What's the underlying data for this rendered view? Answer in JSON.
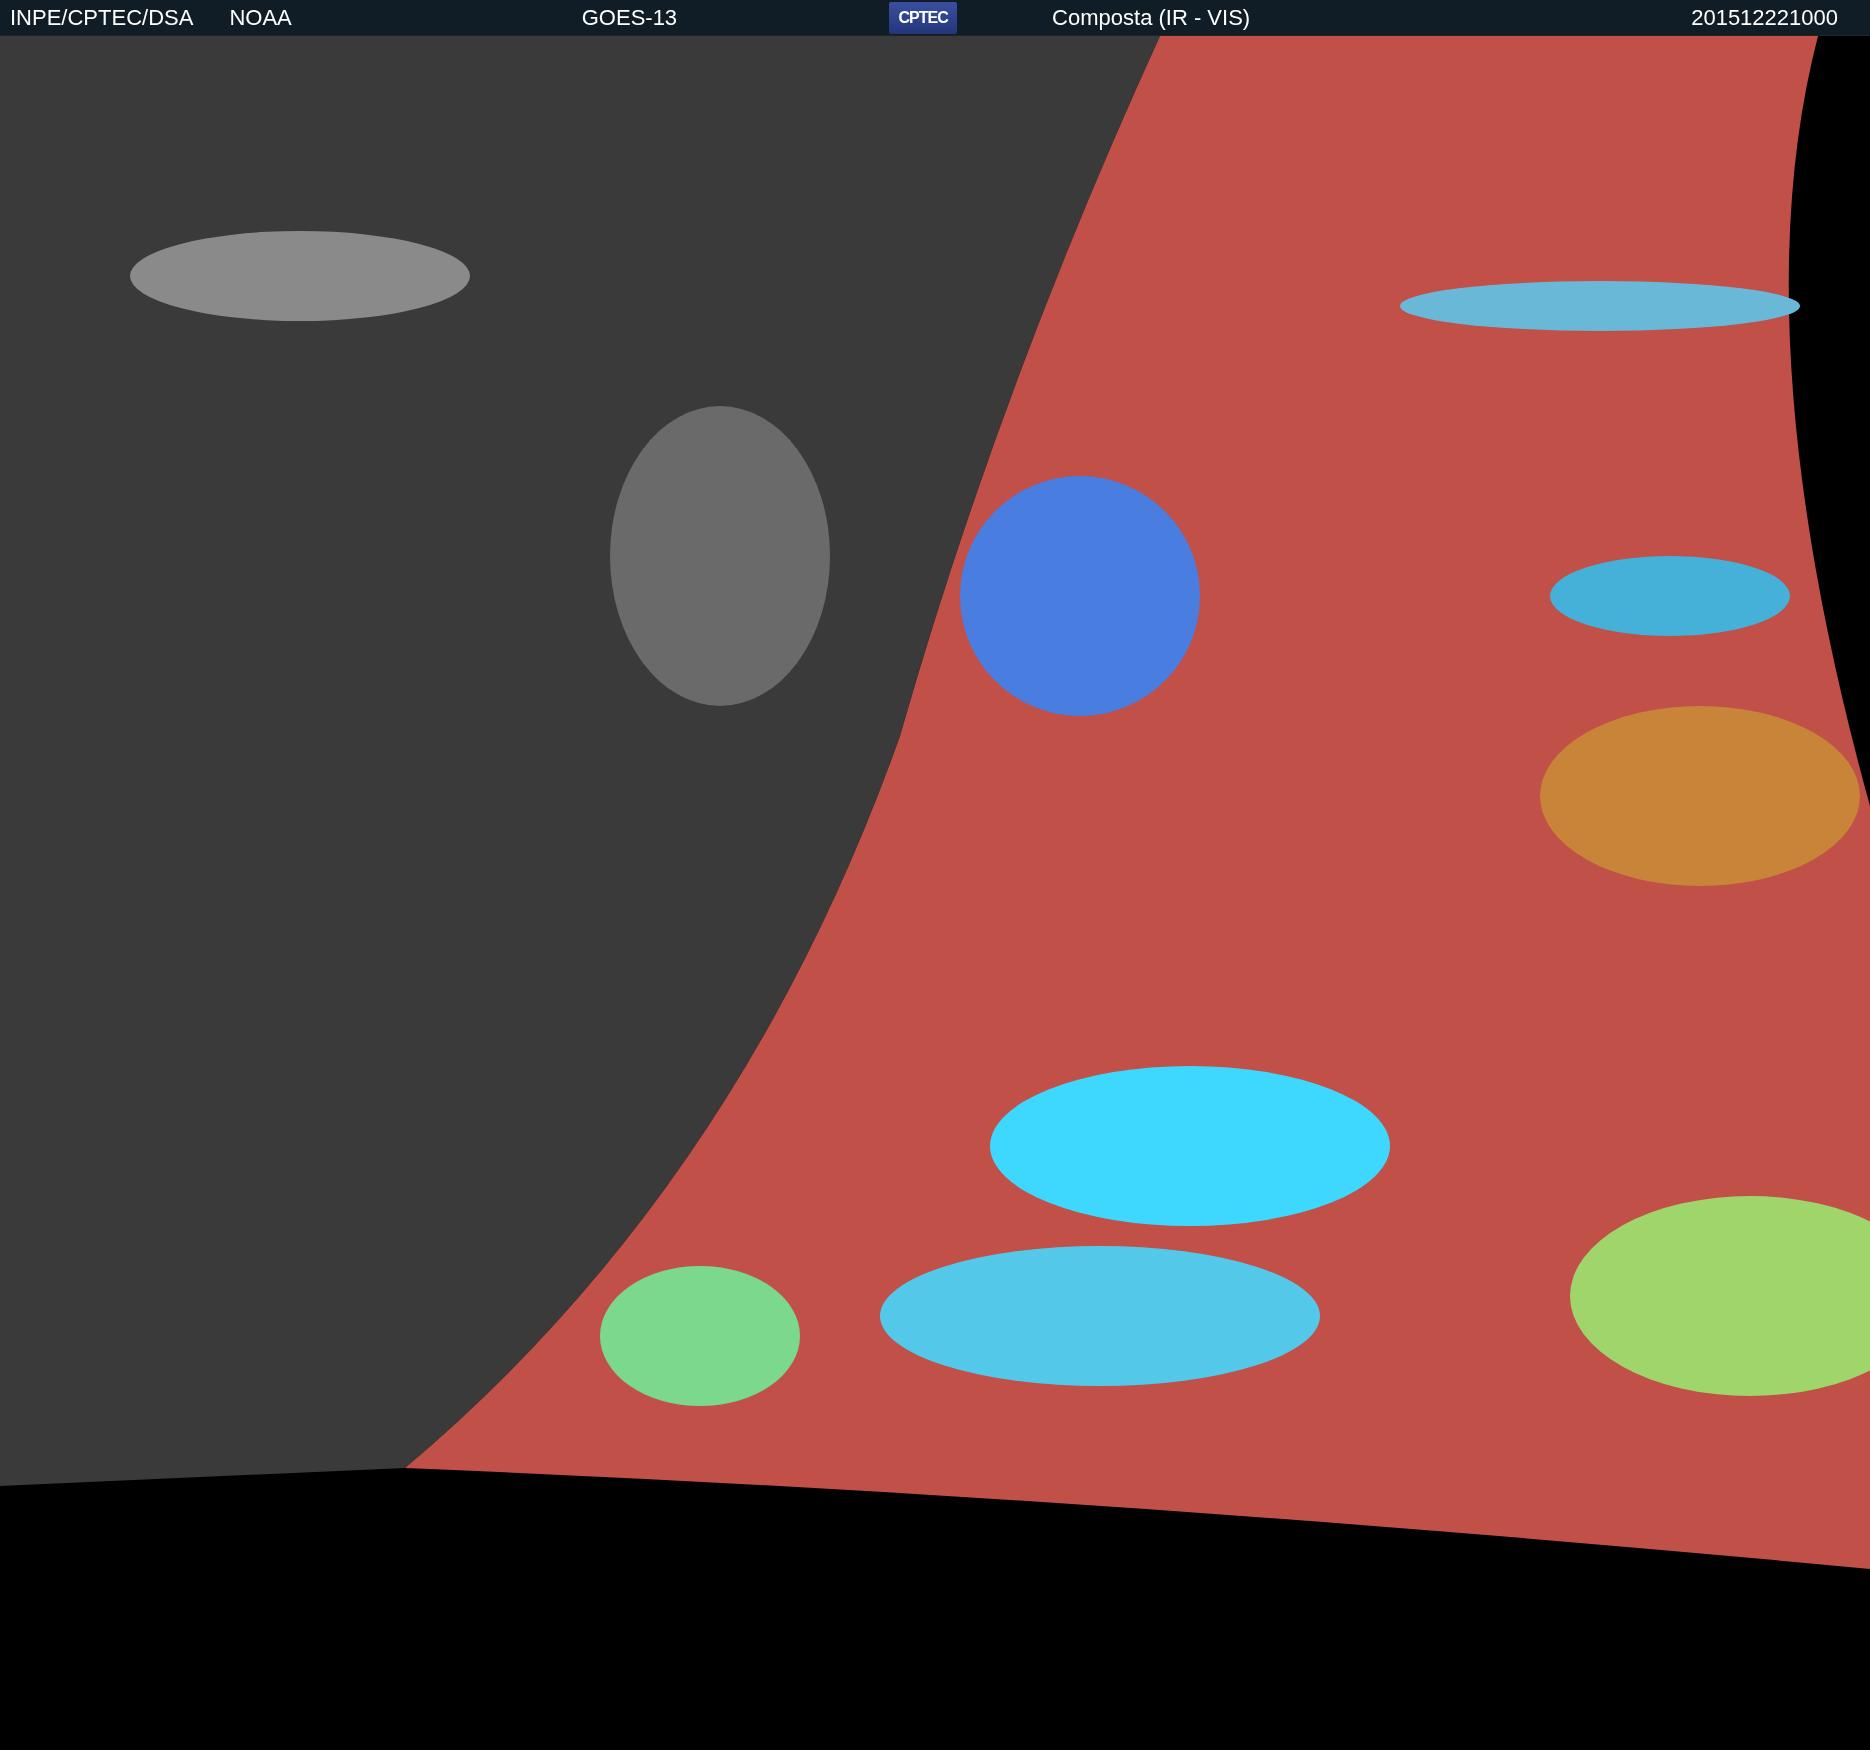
{
  "header": {
    "credits": [
      "INPE/CPTEC/DSA",
      "NOAA"
    ],
    "satellite": "GOES-13",
    "logo": "CPTEC",
    "product": "Composta (IR - VIS)",
    "timestamp": "201512221000"
  }
}
